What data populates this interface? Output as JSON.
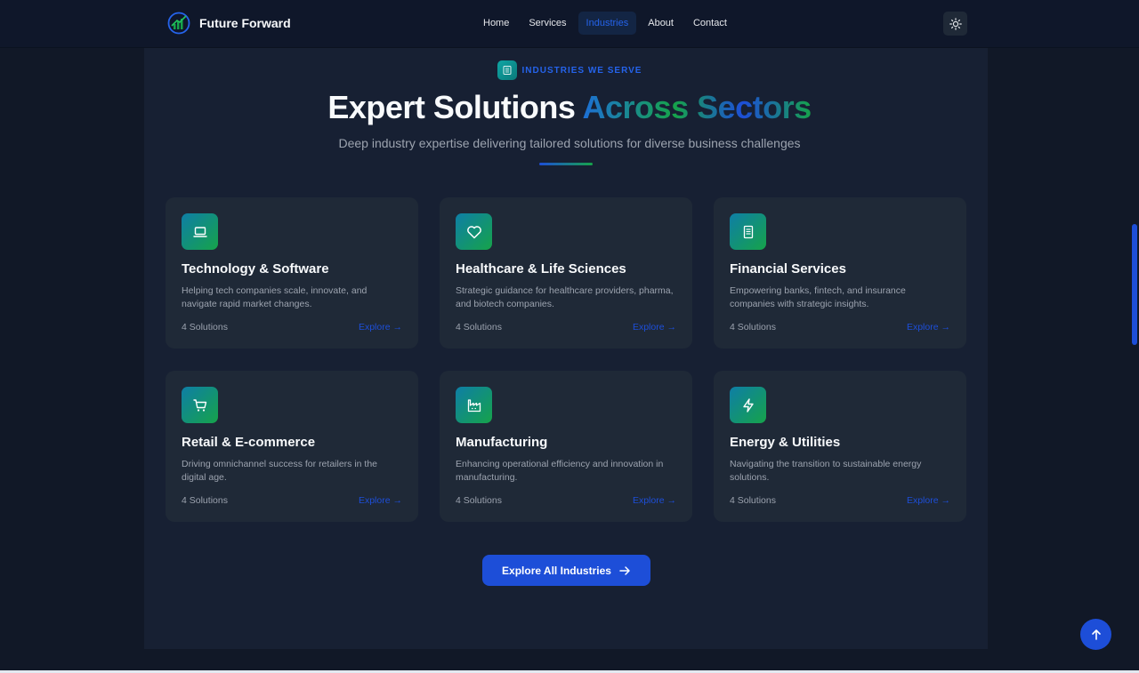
{
  "brand": {
    "name": "Future Forward",
    "icon": "growth-chart-logo-icon"
  },
  "nav": {
    "items": [
      {
        "label": "Home",
        "active": false
      },
      {
        "label": "Services",
        "active": false
      },
      {
        "label": "Industries",
        "active": true
      },
      {
        "label": "About",
        "active": false
      },
      {
        "label": "Contact",
        "active": false
      }
    ],
    "theme_toggle_icon": "sun-icon"
  },
  "section": {
    "eyebrow": "INDUSTRIES WE SERVE",
    "eyebrow_icon": "building-icon",
    "headline_plain": "Expert Solutions",
    "headline_highlight": "Across Sectors",
    "subhead": "Deep industry expertise delivering tailored solutions for diverse business challenges"
  },
  "industries": [
    {
      "title": "Technology & Software",
      "description": "Helping tech companies scale, innovate, and navigate rapid market changes.",
      "count": "4 Solutions",
      "explore": "Explore →",
      "icon": "laptop-icon"
    },
    {
      "title": "Healthcare & Life Sciences",
      "description": "Strategic guidance for healthcare providers, pharma, and biotech companies.",
      "count": "4 Solutions",
      "explore": "Explore →",
      "icon": "heart-icon"
    },
    {
      "title": "Financial Services",
      "description": "Empowering banks, fintech, and insurance companies with strategic insights.",
      "count": "4 Solutions",
      "explore": "Explore →",
      "icon": "receipt-icon"
    },
    {
      "title": "Retail & E-commerce",
      "description": "Driving omnichannel success for retailers in the digital age.",
      "count": "4 Solutions",
      "explore": "Explore →",
      "icon": "shopping-cart-icon"
    },
    {
      "title": "Manufacturing",
      "description": "Enhancing operational efficiency and innovation in manufacturing.",
      "count": "4 Solutions",
      "explore": "Explore →",
      "icon": "factory-icon"
    },
    {
      "title": "Energy & Utilities",
      "description": "Navigating the transition to sustainable energy solutions.",
      "count": "4 Solutions",
      "explore": "Explore →",
      "icon": "lightning-icon"
    }
  ],
  "cta": {
    "label": "Explore All Industries",
    "icon": "arrow-right-icon"
  },
  "scroll_top_icon": "arrow-up-icon",
  "colors": {
    "background": "#111827",
    "panel": "#172033",
    "card": "#1f2937",
    "accent_blue": "#1d4ed8",
    "accent_green": "#16a34a"
  }
}
